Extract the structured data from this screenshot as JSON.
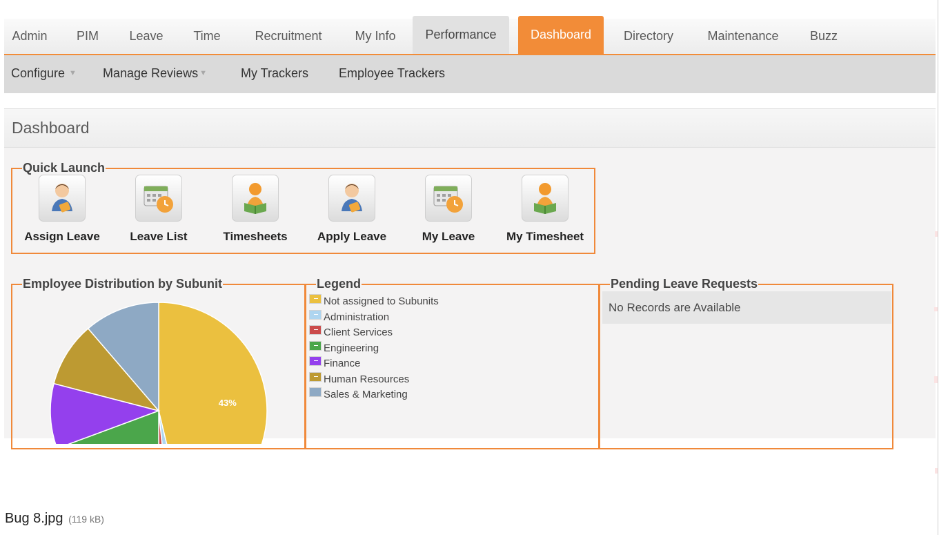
{
  "nav": {
    "main": [
      "Admin",
      "PIM",
      "Leave",
      "Time",
      "Recruitment",
      "My Info",
      "Performance",
      "Dashboard",
      "Directory",
      "Maintenance",
      "Buzz"
    ],
    "sub": [
      "Configure",
      "Manage Reviews",
      "My Trackers",
      "Employee Trackers"
    ],
    "caret_icon": "▼"
  },
  "page": {
    "title": "Dashboard"
  },
  "quick_launch": {
    "title": "Quick Launch",
    "items": [
      {
        "label": "Assign Leave",
        "icon": "person-assign-icon"
      },
      {
        "label": "Leave List",
        "icon": "calendar-list-icon"
      },
      {
        "label": "Timesheets",
        "icon": "person-timesheet-icon"
      },
      {
        "label": "Apply Leave",
        "icon": "person-apply-icon"
      },
      {
        "label": "My Leave",
        "icon": "calendar-leave-icon"
      },
      {
        "label": "My Timesheet",
        "icon": "person-timesheet-icon"
      }
    ]
  },
  "distribution": {
    "title": "Employee Distribution by Subunit"
  },
  "legend": {
    "title": "Legend",
    "items": [
      {
        "label": "Not assigned to Subunits",
        "color": "#ebc03f"
      },
      {
        "label": "Administration",
        "color": "#aed5f0"
      },
      {
        "label": "Client Services",
        "color": "#cb4b4b"
      },
      {
        "label": "Engineering",
        "color": "#4ba64b"
      },
      {
        "label": "Finance",
        "color": "#9440ed"
      },
      {
        "label": "Human Resources",
        "color": "#bd9a32"
      },
      {
        "label": "Sales & Marketing",
        "color": "#8ea9c4"
      }
    ]
  },
  "pending": {
    "title": "Pending Leave Requests",
    "empty_text": "No Records are Available"
  },
  "attachment": {
    "name": "Bug 8.jpg",
    "size": "(119 kB)"
  },
  "chart_data": {
    "type": "pie",
    "categories": [
      "Not assigned to Subunits",
      "Administration",
      "Client Services",
      "Engineering",
      "Finance",
      "Human Resources",
      "Sales & Marketing"
    ],
    "values": [
      43,
      2,
      1.5,
      18,
      9,
      9,
      10.5
    ],
    "data_labels": [
      "43%"
    ],
    "colors": [
      "#ebc03f",
      "#aed5f0",
      "#cb4b4b",
      "#4ba64b",
      "#9440ed",
      "#bd9a32",
      "#8ea9c4"
    ]
  }
}
